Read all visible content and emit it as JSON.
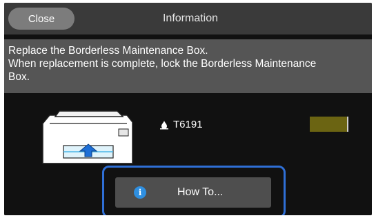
{
  "header": {
    "close_label": "Close",
    "title": "Information"
  },
  "message": {
    "lines": [
      "Replace the Borderless Maintenance Box.",
      "When replacement is complete, lock the Borderless Maintenance",
      "Box."
    ]
  },
  "status": {
    "part_code": "T6191",
    "indicator_color": "#6b6412",
    "icon": "ink-drop-icon"
  },
  "actions": {
    "howto_label": "How To...",
    "howto_icon": "info-icon"
  },
  "colors": {
    "accent": "#2f6fd6",
    "info": "#2f8fe0"
  }
}
